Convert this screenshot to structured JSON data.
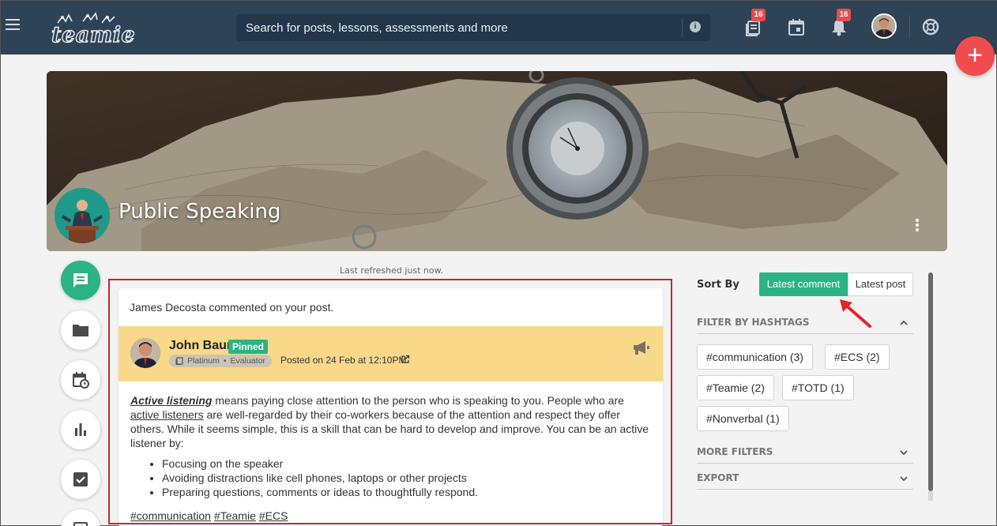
{
  "topbar": {
    "logo_text": "teamie",
    "search_placeholder": "Search for posts, lessons, assessments and more",
    "badges": {
      "library": "16",
      "notifications": "16"
    }
  },
  "banner": {
    "title": "Public Speaking"
  },
  "feed": {
    "refreshed": "Last refreshed just now."
  },
  "post": {
    "notification": "James Decosta commented on your post.",
    "author": "John Baur",
    "pinned_label": "Pinned",
    "role_tier": "Platinum",
    "role_sep": "•",
    "role_name": "Evaluator",
    "posted": "Posted on 24 Feb at 12:10PM",
    "body": {
      "term": "Active listening",
      "p1_a": " means paying close attention to the person who is speaking to you. People who are ",
      "link": "active listeners",
      "p1_b": " are well-regarded by their co-workers because of the attention and respect they offer others. While it seems simple, this is a skill that can be hard to develop and improve. You can be an active listener by:",
      "bullets": [
        "Focusing on the speaker",
        "Avoiding distractions like cell phones, laptops or other projects",
        "Preparing questions, comments or ideas to thoughtfully respond."
      ]
    },
    "hashtags": [
      "#communication",
      "#Teamie",
      "#ECS"
    ]
  },
  "sidebar": {
    "sort_by_label": "Sort By",
    "sort_options": [
      "Latest comment",
      "Latest post"
    ],
    "sort_selected": "Latest comment",
    "filter_by_hashtags_label": "FILTER BY HASHTAGS",
    "hashtag_chips": [
      "#communication (3)",
      "#ECS (2)",
      "#Teamie (2)",
      "#TOTD (1)",
      "#Nonverbal (1)"
    ],
    "more_filters_label": "MORE FILTERS",
    "export_label": "EXPORT"
  },
  "colors": {
    "topbar": "#2e4356",
    "accent_green": "#2bb386",
    "fab_red": "#f04b4f",
    "pinned_header_bg": "#f8d98a",
    "highlight_red": "#c8262b"
  },
  "icons": {
    "rail": [
      "chat-icon",
      "folder-icon",
      "calendar-clock-icon",
      "bar-chart-icon",
      "checkbox-icon",
      "report-icon"
    ],
    "topbar": [
      "hamburger-icon",
      "info-icon",
      "library-icon",
      "calendar-icon",
      "bell-icon",
      "help-lifebuoy-icon",
      "plus-icon"
    ]
  }
}
